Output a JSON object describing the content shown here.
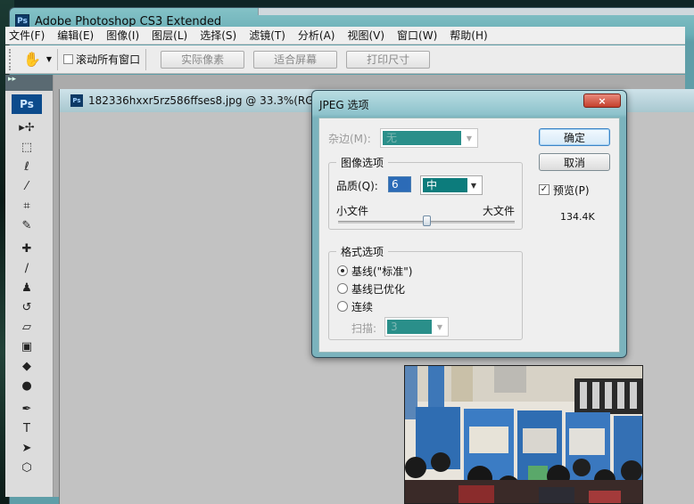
{
  "window": {
    "title": "Adobe Photoshop CS3 Extended",
    "app_badge": "Ps"
  },
  "menu": [
    "文件(F)",
    "编辑(E)",
    "图像(I)",
    "图层(L)",
    "选择(S)",
    "滤镜(T)",
    "分析(A)",
    "视图(V)",
    "窗口(W)",
    "帮助(H)"
  ],
  "options": {
    "scroll_all_label": "滚动所有窗口",
    "actual_pixels": "实际像素",
    "fit_screen": "适合屏幕",
    "print_size": "打印尺寸"
  },
  "toolbox": {
    "badge": "Ps",
    "header": "▸▸"
  },
  "document": {
    "title": "182336hxxr5rz586ffses8.jpg @ 33.3%(RGB/"
  },
  "dialog": {
    "title": "JPEG 选项",
    "close_glyph": "×",
    "matte_label": "杂边(M):",
    "matte_value": "无",
    "image_group": "图像选项",
    "quality_label": "品质(Q):",
    "quality_value": "6",
    "quality_preset": "中",
    "small_file": "小文件",
    "large_file": "大文件",
    "quality_slider_fraction": 0.5,
    "format_group": "格式选项",
    "format_options": [
      "基线(\"标准\")",
      "基线已优化",
      "连续"
    ],
    "scans_label": "扫描:",
    "scans_value": "3",
    "ok": "确定",
    "cancel": "取消",
    "preview_label": "预览(P)",
    "file_size": "134.4K"
  },
  "colors": {
    "accent": "#0c7c7c",
    "title_bar": "#8ec3cc"
  }
}
